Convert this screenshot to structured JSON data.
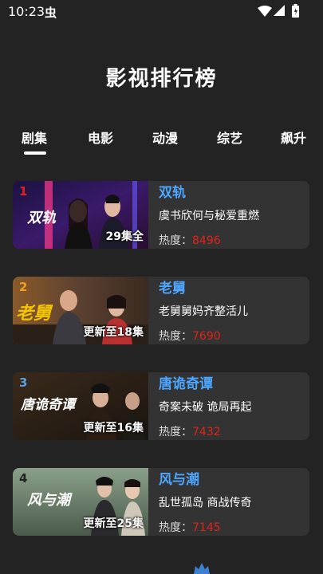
{
  "status_bar": {
    "time": "10:23",
    "bug_icon_glyph": "虫"
  },
  "page_title": "影视排行榜",
  "tabs": [
    {
      "label": "剧集",
      "active": true
    },
    {
      "label": "电影",
      "active": false
    },
    {
      "label": "动漫",
      "active": false
    },
    {
      "label": "综艺",
      "active": false
    },
    {
      "label": "飙升",
      "active": false
    }
  ],
  "heat_label": "热度：",
  "cards": [
    {
      "rank": "1",
      "rank_color": "#e0241b",
      "title": "双轨",
      "desc": "虞书欣何与秘爱重燃",
      "episodes": "29集全",
      "heat": "8496",
      "overlay": "双轨"
    },
    {
      "rank": "2",
      "rank_color": "#f0a020",
      "title": "老舅",
      "desc": "老舅舅妈齐整活儿",
      "episodes": "更新至18集",
      "heat": "7690",
      "overlay": "老舅"
    },
    {
      "rank": "3",
      "rank_color": "#5aa0e0",
      "title": "唐诡奇谭",
      "desc": "奇案未破 诡局再起",
      "episodes": "更新至16集",
      "heat": "7432",
      "overlay": "唐诡奇谭"
    },
    {
      "rank": "4",
      "rank_color": "#222222",
      "title": "风与潮",
      "desc": "乱世孤岛 商战传奇",
      "episodes": "更新至25集",
      "heat": "7145",
      "overlay": "风与潮"
    }
  ],
  "colors": {
    "background": "#232323",
    "card": "#333333",
    "title_blue": "#4da6ff",
    "heat_red": "#e0241b"
  }
}
